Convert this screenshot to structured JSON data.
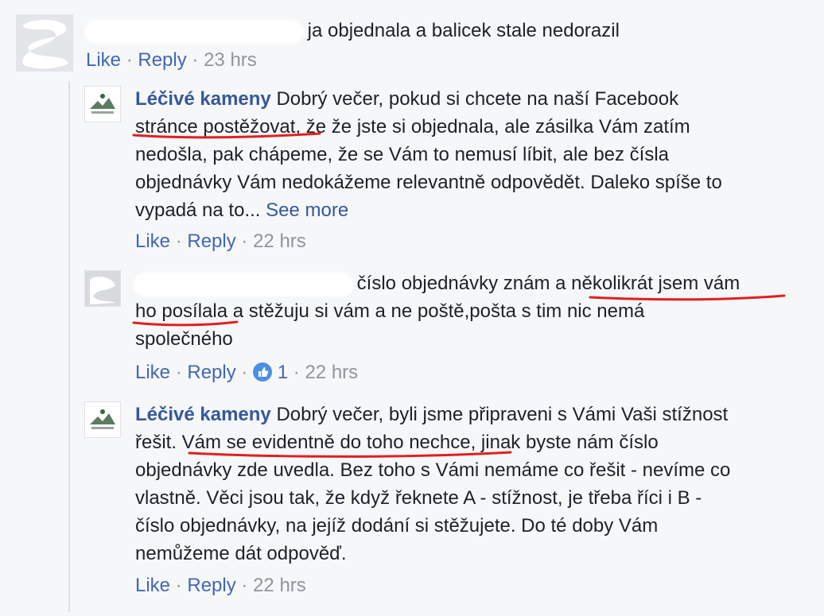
{
  "comments": [
    {
      "id": "c1",
      "author_redacted": true,
      "body": "ja objednala a balicek stale nedorazil",
      "meta": {
        "like": "Like",
        "reply": "Reply",
        "sep": "·",
        "time": "23 hrs"
      }
    },
    {
      "id": "r1",
      "author": "Léčivé kameny",
      "lines": [
        "Dobrý večer, pokud si chcete na naší Facebook",
        "stránce postěžovat, že že jste si objednala, ale zásilka Vám zatím",
        "nedošla, pak chápeme, že se Vám to nemusí líbit, ale bez čísla",
        "objednávky Vám nedokážeme relevantně odpovědět. Daleko spíše to",
        "vypadá na to..."
      ],
      "see_more": "See more",
      "meta": {
        "like": "Like",
        "reply": "Reply",
        "sep": "·",
        "time": "22 hrs"
      }
    },
    {
      "id": "r2",
      "author_redacted": true,
      "lines": [
        "číslo objednávky znám a několikrát jsem vám",
        "ho posílala a stěžuju si vám a ne poště,pošta s tim nic nemá",
        "společného"
      ],
      "meta": {
        "like": "Like",
        "reply": "Reply",
        "sep": "·",
        "reactions": "1",
        "time": "22 hrs"
      }
    },
    {
      "id": "r3",
      "author": "Léčivé kameny",
      "lines": [
        "Dobrý večer, byli jsme připraveni s Vámi Vaši stížnost",
        "řešit. Vám se evidentně do toho nechce, jinak byste nám číslo",
        "objednávky zde uvedla. Bez toho s Vámi nemáme co řešit - nevíme co",
        "vlastně. Věci jsou tak, že když řeknete A - stížnost, je třeba říci i B -",
        "číslo objednávky, na jejíž dodání si stěžujete. Do té doby Vám",
        "nemůžeme dát odpověď."
      ],
      "meta": {
        "like": "Like",
        "reply": "Reply",
        "sep": "·",
        "time": "22 hrs"
      }
    }
  ],
  "icons": {
    "like_reaction": "thumbs-up-icon",
    "page_logo": "leaf-logo-icon"
  },
  "colors": {
    "name": "#365899",
    "link": "#4267b2",
    "meta": "#90949c",
    "annotation": "#e02020",
    "like_badge": "#4a90e2"
  }
}
